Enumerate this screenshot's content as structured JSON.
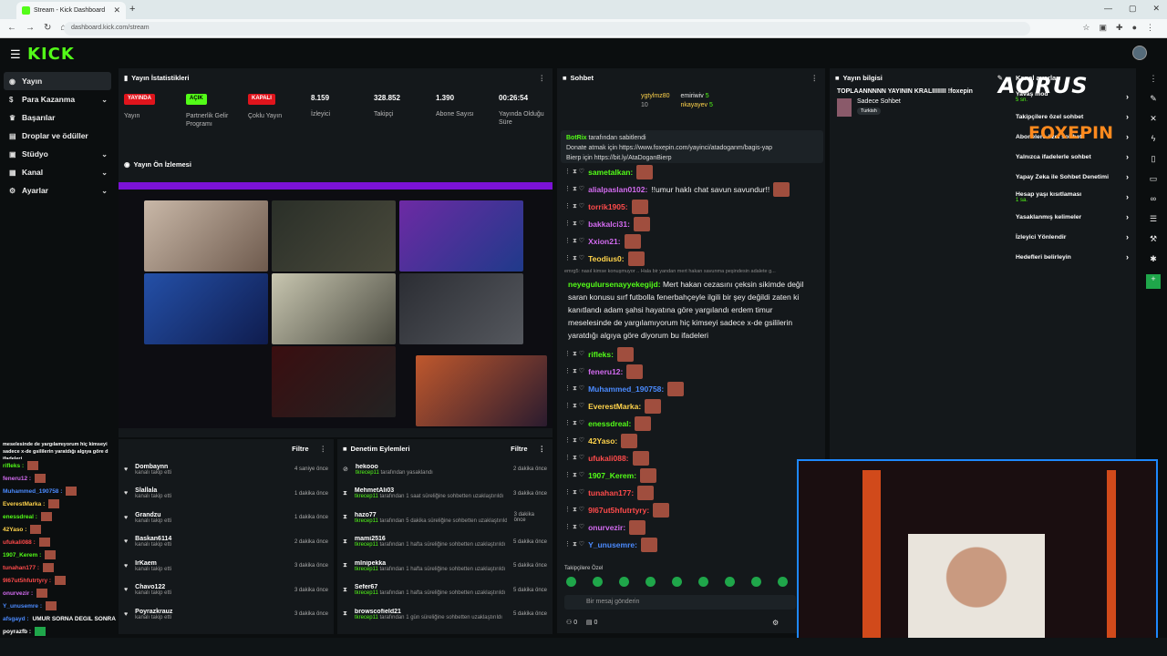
{
  "browser": {
    "tab_title": "Stream - Kick Dashboard",
    "url": "dashboard.kick.com/stream"
  },
  "brand": {
    "logo": "KICK"
  },
  "sidebar": {
    "items": [
      {
        "label": "Yayın",
        "icon": "broadcast-icon"
      },
      {
        "label": "Para Kazanma",
        "icon": "money-icon"
      },
      {
        "label": "Başarılar",
        "icon": "trophy-icon"
      },
      {
        "label": "Droplar ve ödüller",
        "icon": "gift-icon"
      },
      {
        "label": "Stüdyo",
        "icon": "studio-icon"
      },
      {
        "label": "Kanal",
        "icon": "channel-icon"
      },
      {
        "label": "Ayarlar",
        "icon": "gear-icon"
      }
    ]
  },
  "stats": {
    "title": "Yayın İstatistikleri",
    "items": [
      {
        "value": "YAYINDA",
        "label": "Yayın",
        "badge_color": "#e0141c"
      },
      {
        "value": "AÇIK",
        "label": "Partnerlik Gelir Programı",
        "badge_color": "#53fc18"
      },
      {
        "value": "KAPALI",
        "label": "Çoklu Yayın",
        "badge_color": "#e0141c"
      },
      {
        "value": "8.159",
        "label": "İzleyici"
      },
      {
        "value": "328.852",
        "label": "Takipçi"
      },
      {
        "value": "1.390",
        "label": "Abone Sayısı"
      },
      {
        "value": "00:26:54",
        "label": "Yayında Olduğu Süre"
      }
    ]
  },
  "preview": {
    "title": "Yayın Ön İzlemesi"
  },
  "chat": {
    "title": "Sohbet",
    "top_gifters": [
      {
        "name": "ygtylmz80",
        "count": "10"
      },
      {
        "name": "emiriwiv",
        "count": "5"
      },
      {
        "name": "nkayayev",
        "count": "5"
      }
    ],
    "pinned": {
      "by": "BotRix",
      "by_suffix": "tarafından sabitlendi",
      "line1": "Donate atmak için https://www.foxepin.com/yayinci/atadoganm/bagis-yap",
      "line2": "Bierp için https://bit.ly/AtaDoganBierp"
    },
    "messages": [
      {
        "user": "sametalkan:",
        "text": "",
        "color": "#53fc18"
      },
      {
        "user": "alialpaslan0102:",
        "text": "!!umur haklı chat savun savundur!!",
        "color": "#d36bf0"
      },
      {
        "user": "torrik1905:",
        "text": "",
        "color": "#ff4b4b"
      },
      {
        "user": "bakkalci31:",
        "text": "",
        "color": "#d36bf0"
      },
      {
        "user": "Xxion21:",
        "text": "",
        "color": "#d36bf0"
      },
      {
        "user": "Teodius0:",
        "text": "",
        "color": "#ffd34b"
      }
    ],
    "reply_hint": "emrg5: nasıl kimse konuşmuyor .. Hala bir yandan mert hakan savunma peşindesin adalete g...",
    "long_user": "neyegulursenayyekegijd:",
    "long_text": "Mert hakan cezasını çeksin sikimde değil saran konusu sırf futbolla fenerbahçeyle ilgili bir şey değildi zaten ki kanıtlandı adam şahsi hayatına göre yargılandı erdem timur meselesinde de yargılamıyorum hiç kimseyi sadece x-de gsililerin yaratdığı algıya göre diyorum bu ifadeleri",
    "messages2": [
      {
        "user": "rifleks:",
        "color": "#53fc18"
      },
      {
        "user": "feneru12:",
        "color": "#d36bf0"
      },
      {
        "user": "Muhammed_190758:",
        "color": "#4b8bff"
      },
      {
        "user": "EverestMarka:",
        "color": "#ffd34b"
      },
      {
        "user": "enessdreal:",
        "color": "#53fc18"
      },
      {
        "user": "42Yaso:",
        "color": "#ffd34b"
      },
      {
        "user": "ufukali088:",
        "color": "#ff4b4b"
      },
      {
        "user": "1907_Kerem:",
        "color": "#53fc18"
      },
      {
        "user": "tunahan177:",
        "color": "#ff4b4b"
      },
      {
        "user": "9l67ut5hfutrtyry:",
        "color": "#ff4b4b"
      },
      {
        "user": "onurvezir:",
        "color": "#d36bf0"
      },
      {
        "user": "Y_unusemre:",
        "color": "#4b8bff"
      }
    ],
    "followers_only": "Takipçilere Özel",
    "input_placeholder": "Bir mesaj gönderin",
    "viewer_count": "0",
    "other_count": "0"
  },
  "info": {
    "title": "Yayın bilgisi",
    "stream_title": "TOPLAANNNNN YAYININ KRALIIIIIIII !foxepin",
    "category": "Sadece Sohbet",
    "tag": "Turkish"
  },
  "settings": {
    "title": "Kanal ayarları",
    "items": [
      {
        "label": "Yavaş mod",
        "sub": "5 sn."
      },
      {
        "label": "Takipçilere özel sohbet",
        "sub": ""
      },
      {
        "label": "Abonelere özel sohbet",
        "sub": ""
      },
      {
        "label": "Yalnızca ifadelerle sohbet",
        "sub": ""
      },
      {
        "label": "Yapay Zeka ile Sohbet Denetimi",
        "sub": ""
      },
      {
        "label": "Hesap yaşı kısıtlaması",
        "sub": "1 sa."
      },
      {
        "label": "Yasaklanmış kelimeler",
        "sub": ""
      },
      {
        "label": "İzleyici Yönlendir",
        "sub": ""
      },
      {
        "label": "Hedefleri belirleyin",
        "sub": ""
      }
    ]
  },
  "followers": {
    "filter": "Filtre",
    "items": [
      {
        "name": "Dombaynn",
        "sub": "kanalı takip etti",
        "time": "4 saniye önce"
      },
      {
        "name": "Slallala",
        "sub": "kanalı takip etti",
        "time": "1 dakika önce"
      },
      {
        "name": "Grandzu",
        "sub": "kanalı takip etti",
        "time": "1 dakika önce"
      },
      {
        "name": "Baskan6114",
        "sub": "kanalı takip etti",
        "time": "2 dakika önce"
      },
      {
        "name": "IrKaem",
        "sub": "kanalı takip etti",
        "time": "3 dakika önce"
      },
      {
        "name": "Chavo122",
        "sub": "kanalı takip etti",
        "time": "3 dakika önce"
      },
      {
        "name": "Poyrazkrauz",
        "sub": "kanalı takip etti",
        "time": "3 dakika önce"
      }
    ]
  },
  "moderation": {
    "title": "Denetim Eylemleri",
    "filter": "Filtre",
    "items": [
      {
        "name": "hekooo",
        "mod": "tkrecep11",
        "sub": "tarafından yasaklandı",
        "time": "2 dakika önce"
      },
      {
        "name": "MehmetAli03",
        "mod": "tkrecep11",
        "sub": "tarafından 1 saat süreliğine sohbetten uzaklaştırıldı",
        "time": "3 dakika önce"
      },
      {
        "name": "hazo77",
        "mod": "tkrecep11",
        "sub": "tarafından 5 dakika süreliğine sohbetten uzaklaştırıldı",
        "time": "3 dakika önce"
      },
      {
        "name": "mami2516",
        "mod": "tkrecep11",
        "sub": "tarafından 1 hafta süreliğine sohbetten uzaklaştırıldı",
        "time": "5 dakika önce"
      },
      {
        "name": "mlnipekka",
        "mod": "tkrecep11",
        "sub": "tarafından 1 hafta süreliğine sohbetten uzaklaştırıldı",
        "time": "5 dakika önce"
      },
      {
        "name": "Sefer67",
        "mod": "tkrecep11",
        "sub": "tarafından 1 hafta süreliğine sohbetten uzaklaştırıldı",
        "time": "5 dakika önce"
      },
      {
        "name": "browscofield21",
        "mod": "tkrecep11",
        "sub": "tarafından 1 gün süreliğine sohbetten uzaklaştırıldı",
        "time": "5 dakika önce"
      }
    ]
  },
  "overlay_chat": {
    "header": "meselesinde de yargılamıyorum hiç kimseyi sadece x-de gsililerin yaratdığı algıya göre d ifadeleri",
    "lines": [
      {
        "user": "rifleks :",
        "color": "#53fc18"
      },
      {
        "user": "feneru12 :",
        "color": "#d36bf0"
      },
      {
        "user": "Muhammed_190758 :",
        "color": "#4b8bff"
      },
      {
        "user": "EverestMarka :",
        "color": "#ffd34b"
      },
      {
        "user": "enessdreal :",
        "color": "#53fc18"
      },
      {
        "user": "42Yaso :",
        "color": "#ffd34b"
      },
      {
        "user": "ufukali088 :",
        "color": "#ff4b4b"
      },
      {
        "user": "1907_Kerem :",
        "color": "#53fc18"
      },
      {
        "user": "tunahan177 :",
        "color": "#ff4b4b"
      },
      {
        "user": "9l67ut5hfutrtyry :",
        "color": "#ff4b4b"
      },
      {
        "user": "onurvezir :",
        "color": "#d36bf0"
      },
      {
        "user": "Y_unusemre :",
        "color": "#4b8bff"
      }
    ],
    "last_user": "afsgayd :",
    "last_text": "UMUR SORNA DEGIL SONRA",
    "last2": "poyrazfb :"
  },
  "overlay_brands": {
    "aorus": "AORUS",
    "foxepin": "FOXEPIN"
  },
  "colors": {
    "accent": "#53fc18",
    "live": "#e0141c",
    "panel": "#14181b",
    "bg": "#0b0e0f"
  }
}
